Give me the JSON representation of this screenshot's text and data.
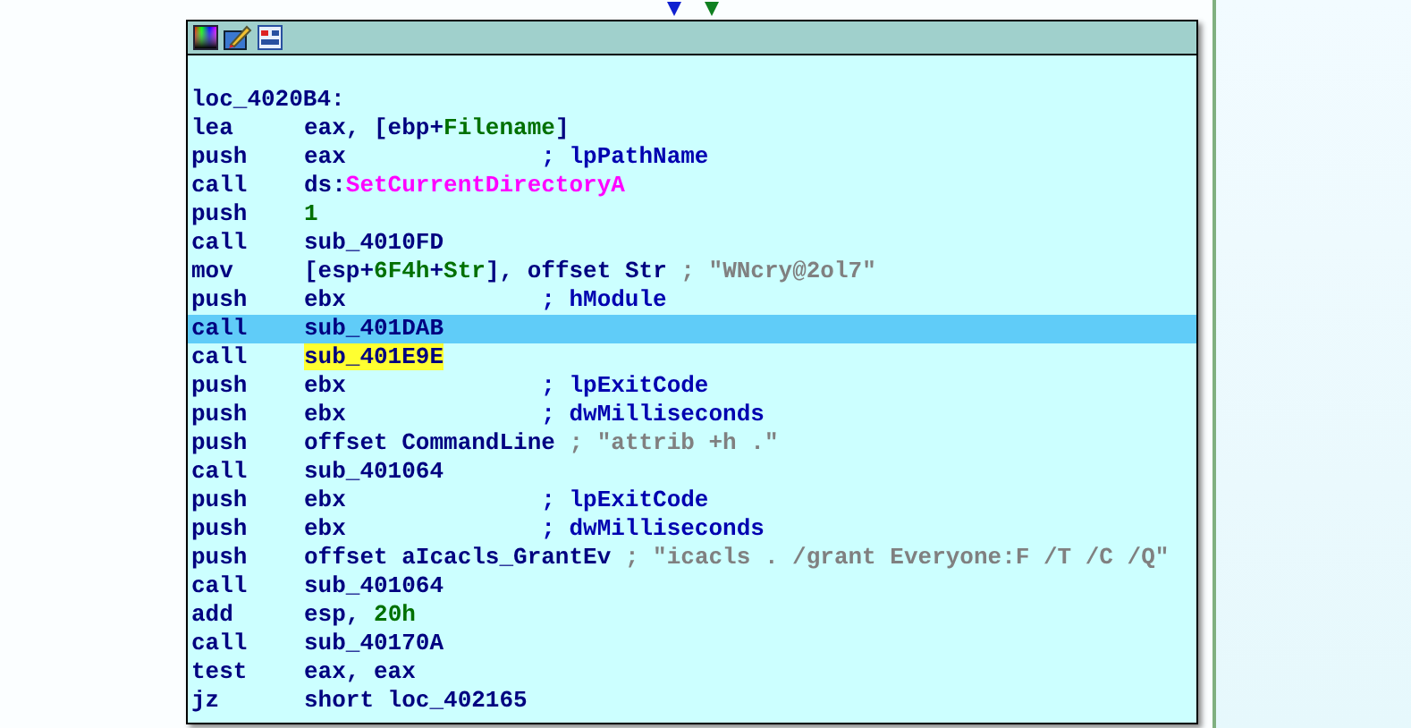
{
  "label": "loc_4020B4:",
  "rows": [
    {
      "mnemonic": "lea",
      "operand": [
        {
          "kind": "text",
          "text": "eax, [ebp+"
        },
        {
          "kind": "name",
          "text": "Filename"
        },
        {
          "kind": "text",
          "text": "]"
        }
      ],
      "selected": false
    },
    {
      "mnemonic": "push",
      "operand": [
        {
          "kind": "text",
          "text": "eax"
        }
      ],
      "comment": {
        "kind": "name",
        "text": "; lpPathName"
      },
      "selected": false
    },
    {
      "mnemonic": "call",
      "operand": [
        {
          "kind": "text",
          "text": "ds:"
        },
        {
          "kind": "import",
          "text": "SetCurrentDirectoryA"
        }
      ],
      "selected": false
    },
    {
      "mnemonic": "push",
      "operand": [
        {
          "kind": "number",
          "text": "1"
        }
      ],
      "selected": false
    },
    {
      "mnemonic": "call",
      "operand": [
        {
          "kind": "text",
          "text": "sub_4010FD"
        }
      ],
      "selected": false
    },
    {
      "mnemonic": "mov",
      "operand": [
        {
          "kind": "text",
          "text": "[esp+"
        },
        {
          "kind": "name",
          "text": "6F4h"
        },
        {
          "kind": "text",
          "text": "+"
        },
        {
          "kind": "name",
          "text": "Str"
        },
        {
          "kind": "text",
          "text": "], offset Str"
        }
      ],
      "comment": {
        "kind": "string",
        "text": "; \"WNcry@2ol7\""
      },
      "selected": false
    },
    {
      "mnemonic": "push",
      "operand": [
        {
          "kind": "text",
          "text": "ebx"
        }
      ],
      "comment": {
        "kind": "name",
        "text": "; hModule"
      },
      "selected": false
    },
    {
      "mnemonic": "call",
      "operand": [
        {
          "kind": "text",
          "text": "sub_401DAB"
        }
      ],
      "selected": true
    },
    {
      "mnemonic": "call",
      "operand": [
        {
          "kind": "highlight",
          "text": "sub_401E9E"
        }
      ],
      "selected": false
    },
    {
      "mnemonic": "push",
      "operand": [
        {
          "kind": "text",
          "text": "ebx"
        }
      ],
      "comment": {
        "kind": "name",
        "text": "; lpExitCode"
      },
      "selected": false
    },
    {
      "mnemonic": "push",
      "operand": [
        {
          "kind": "text",
          "text": "ebx"
        }
      ],
      "comment": {
        "kind": "name",
        "text": "; dwMilliseconds"
      },
      "selected": false
    },
    {
      "mnemonic": "push",
      "operand": [
        {
          "kind": "text",
          "text": "offset CommandLine"
        }
      ],
      "comment": {
        "kind": "string",
        "text": "; \"attrib +h .\""
      },
      "selected": false
    },
    {
      "mnemonic": "call",
      "operand": [
        {
          "kind": "text",
          "text": "sub_401064"
        }
      ],
      "selected": false
    },
    {
      "mnemonic": "push",
      "operand": [
        {
          "kind": "text",
          "text": "ebx"
        }
      ],
      "comment": {
        "kind": "name",
        "text": "; lpExitCode"
      },
      "selected": false
    },
    {
      "mnemonic": "push",
      "operand": [
        {
          "kind": "text",
          "text": "ebx"
        }
      ],
      "comment": {
        "kind": "name",
        "text": "; dwMilliseconds"
      },
      "selected": false
    },
    {
      "mnemonic": "push",
      "operand": [
        {
          "kind": "text",
          "text": "offset aIcacls_GrantEv"
        }
      ],
      "comment": {
        "kind": "string",
        "text": "; \"icacls . /grant Everyone:F /T /C /Q\""
      },
      "selected": false
    },
    {
      "mnemonic": "call",
      "operand": [
        {
          "kind": "text",
          "text": "sub_401064"
        }
      ],
      "selected": false
    },
    {
      "mnemonic": "add",
      "operand": [
        {
          "kind": "text",
          "text": "esp, "
        },
        {
          "kind": "number",
          "text": "20h"
        }
      ],
      "selected": false
    },
    {
      "mnemonic": "call",
      "operand": [
        {
          "kind": "text",
          "text": "sub_40170A"
        }
      ],
      "selected": false
    },
    {
      "mnemonic": "test",
      "operand": [
        {
          "kind": "text",
          "text": "eax, eax"
        }
      ],
      "selected": false
    },
    {
      "mnemonic": "jz",
      "operand": [
        {
          "kind": "text",
          "text": "short loc_402165"
        }
      ],
      "selected": false
    }
  ]
}
